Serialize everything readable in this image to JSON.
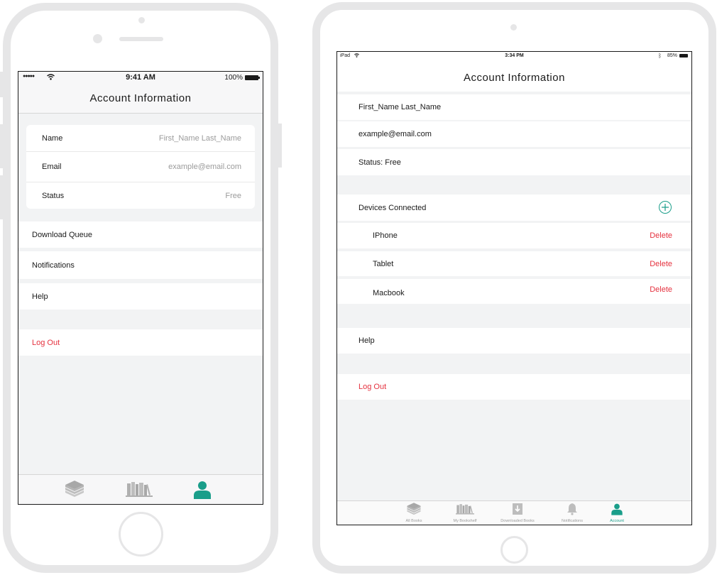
{
  "phone": {
    "status": {
      "carrier_dots": "●●●●●",
      "time": "9:41 AM",
      "battery": "100%"
    },
    "title": "Account Information",
    "account_card": [
      {
        "label": "Name",
        "value": "First_Name Last_Name"
      },
      {
        "label": "Email",
        "value": "example@email.com"
      },
      {
        "label": "Status",
        "value": "Free"
      }
    ],
    "menu": [
      {
        "label": "Download Queue"
      },
      {
        "label": "Notifications"
      },
      {
        "label": "Help"
      }
    ],
    "logout": "Log Out",
    "tabs": [
      {
        "icon": "all-books-icon",
        "active": false
      },
      {
        "icon": "bookshelf-icon",
        "active": false
      },
      {
        "icon": "account-icon",
        "active": true
      }
    ]
  },
  "tablet": {
    "status": {
      "device": "iPad",
      "time": "3:34 PM",
      "battery": "85%"
    },
    "title": "Account Information",
    "info": [
      {
        "text": "First_Name Last_Name"
      },
      {
        "text": "example@email.com"
      },
      {
        "text": "Status: Free"
      }
    ],
    "devices_header": "Devices Connected",
    "devices": [
      {
        "name": "IPhone",
        "action": "Delete"
      },
      {
        "name": "Tablet",
        "action": "Delete"
      },
      {
        "name": "Macbook",
        "action": "Delete"
      }
    ],
    "help": "Help",
    "logout": "Log Out",
    "tabs": [
      {
        "label": "All Books",
        "icon": "all-books-icon",
        "active": false
      },
      {
        "label": "My Bookshelf",
        "icon": "bookshelf-icon",
        "active": false
      },
      {
        "label": "Downloaded Books",
        "icon": "download-icon",
        "active": false
      },
      {
        "label": "Notifications",
        "icon": "bell-icon",
        "active": false
      },
      {
        "label": "Account",
        "icon": "account-icon",
        "active": true
      }
    ]
  },
  "colors": {
    "accent": "#1a9e8a",
    "danger": "#e5323f",
    "frame": "#e6e6e7",
    "background": "#f2f3f4"
  }
}
